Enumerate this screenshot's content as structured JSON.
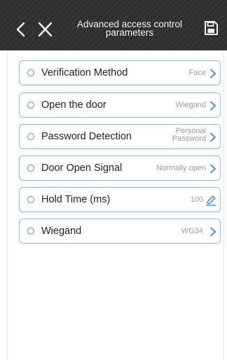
{
  "header": {
    "title_line1": "Advanced access control",
    "title_line2": "parameters",
    "back_icon": "chevron-left-icon",
    "close_icon": "close-icon",
    "save_icon": "save-icon"
  },
  "colors": {
    "header_bg": "#2f2f2f",
    "accent": "#4a90e2",
    "row_border": "#8fb6e6",
    "value_text": "#9a9a9a"
  },
  "rows": [
    {
      "label": "Verification Method",
      "value": "Face",
      "icon": "chevron-right-icon"
    },
    {
      "label": "Open the door",
      "value": "Wiegand",
      "icon": "chevron-right-icon"
    },
    {
      "label": "Password Detection",
      "value_line1": "Personal",
      "value_line2": "Password",
      "icon": "chevron-right-icon"
    },
    {
      "label": "Door Open Signal",
      "value": "Normally open",
      "icon": "chevron-right-icon"
    },
    {
      "label": "Hold Time (ms)",
      "value": "100",
      "icon": "edit-pencil-icon"
    },
    {
      "label": "Wiegand",
      "value": "WG34",
      "icon": "chevron-right-icon"
    }
  ]
}
